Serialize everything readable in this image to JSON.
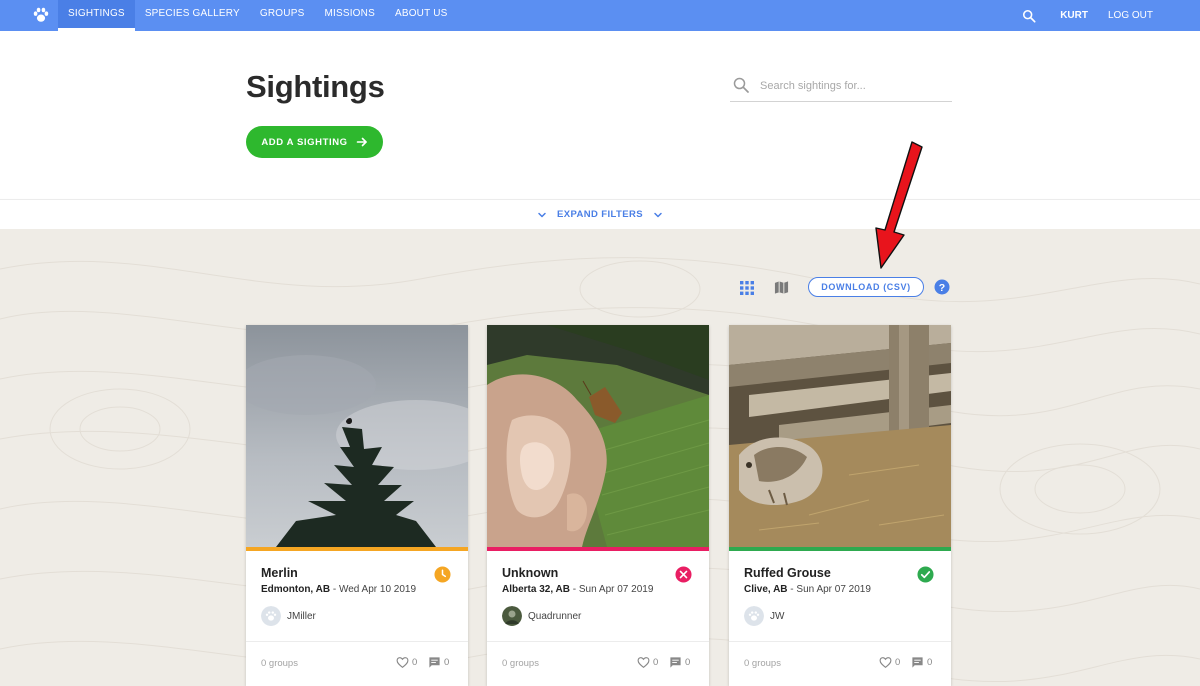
{
  "nav": {
    "items": [
      {
        "label": "SIGHTINGS",
        "active": true
      },
      {
        "label": "SPECIES GALLERY"
      },
      {
        "label": "GROUPS"
      },
      {
        "label": "MISSIONS"
      },
      {
        "label": "ABOUT US"
      }
    ],
    "user": "KURT",
    "logout": "LOG OUT",
    "icons": {
      "logo": "paw-icon",
      "search": "search-icon"
    }
  },
  "header": {
    "title": "Sightings",
    "search_placeholder": "Search sightings for...",
    "search_value": "",
    "add_button": "ADD A SIGHTING"
  },
  "filters": {
    "label": "EXPAND FILTERS"
  },
  "toolbar": {
    "download_label": "DOWNLOAD (CSV)",
    "icons": [
      "grid-view-icon",
      "map-view-icon",
      "help-icon"
    ]
  },
  "annotation": {
    "type": "red arrow pointing at download button"
  },
  "colors": {
    "nav": "#5b8ff2",
    "accent": "#4a7fe6",
    "add_button": "#2eb82e",
    "pending": "#f5a623",
    "rejected": "#e91e63",
    "approved": "#2eaa4f"
  },
  "cards": [
    {
      "title": "Merlin",
      "location": "Edmonton, AB",
      "date": "Wed Apr 10 2019",
      "status": "pending",
      "status_icon": "clock-icon",
      "user": "JMiller",
      "groups": "0 groups",
      "likes": "0",
      "comments": "0"
    },
    {
      "title": "Unknown",
      "location": "Alberta 32, AB",
      "date": "Sun Apr 07 2019",
      "status": "rejected",
      "status_icon": "x-circle-icon",
      "user": "Quadrunner",
      "groups": "0 groups",
      "likes": "0",
      "comments": "0"
    },
    {
      "title": "Ruffed Grouse",
      "location": "Clive, AB",
      "date": "Sun Apr 07 2019",
      "status": "approved",
      "status_icon": "check-circle-icon",
      "user": "JW",
      "groups": "0 groups",
      "likes": "0",
      "comments": "0"
    }
  ]
}
